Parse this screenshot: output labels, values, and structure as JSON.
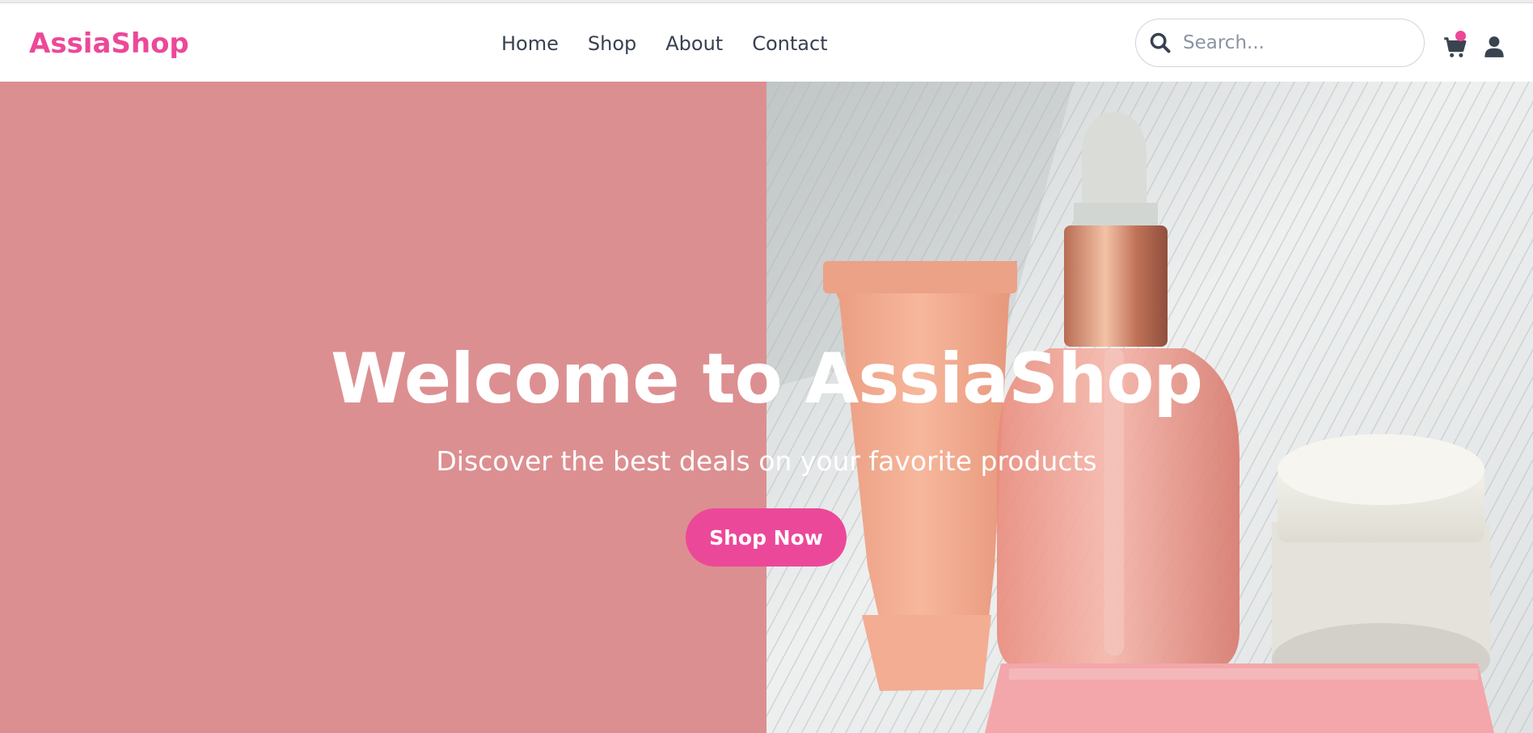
{
  "brand": {
    "name": "AssiaShop",
    "color": "#ec4899"
  },
  "nav": {
    "links": [
      {
        "label": "Home"
      },
      {
        "label": "Shop"
      },
      {
        "label": "About"
      },
      {
        "label": "Contact"
      }
    ]
  },
  "search": {
    "placeholder": "Search...",
    "value": "",
    "icon": "search-icon"
  },
  "actions": {
    "cart_icon": "cart-icon",
    "cart_badge": true,
    "user_icon": "user-icon"
  },
  "hero": {
    "title": "Welcome to AssiaShop",
    "subtitle": "Discover the best deals on your favorite products",
    "cta_label": "Shop Now",
    "left_panel_color": "#dc8f91",
    "image_subject": "Pink skincare products: tube, dropper bottle, jar on white textured fabric"
  },
  "colors": {
    "accent": "#ec4899",
    "text": "#374151",
    "hero_text": "#ffffff"
  }
}
